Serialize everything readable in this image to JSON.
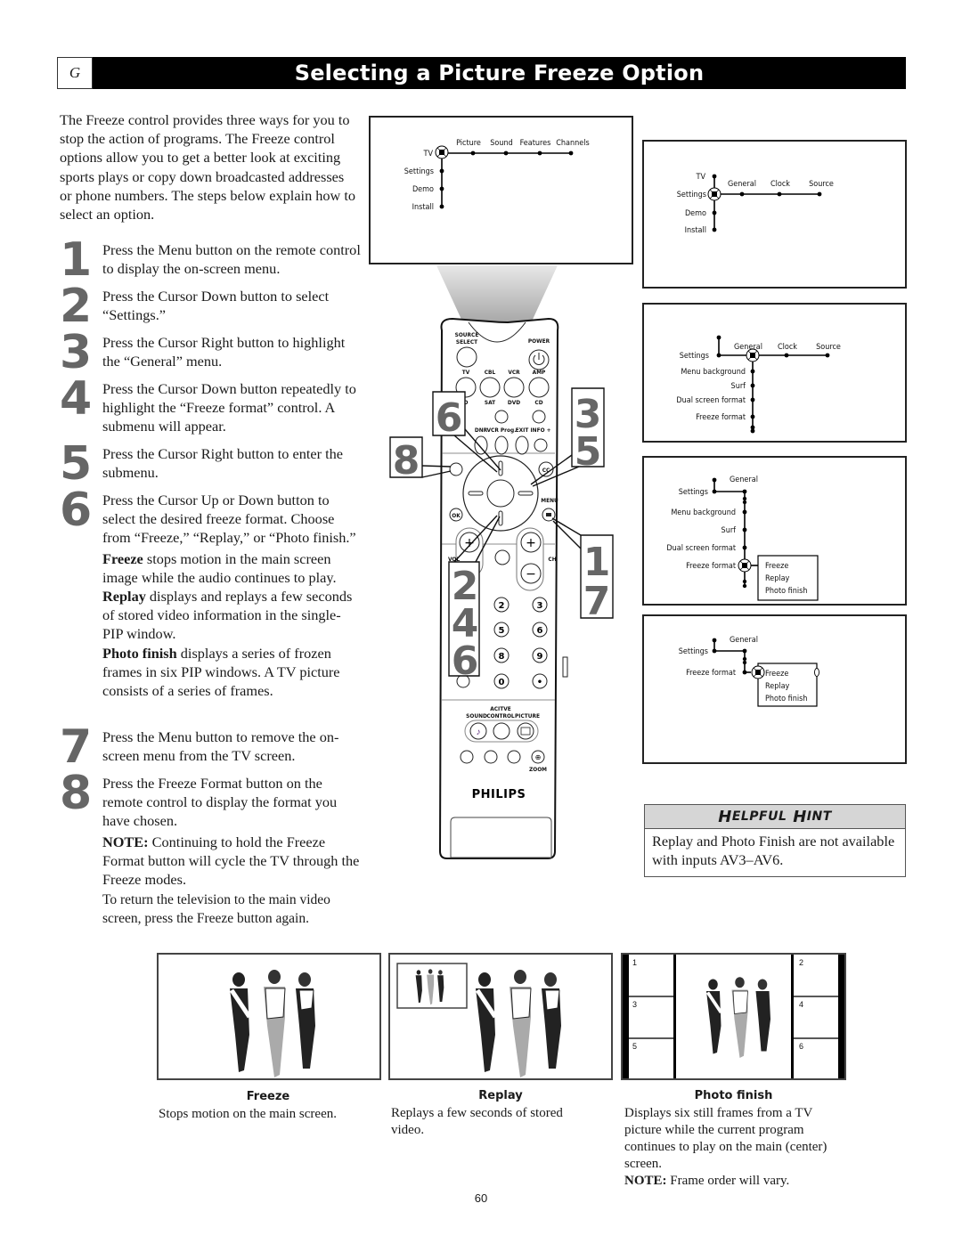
{
  "header": {
    "section_letter": "G",
    "title": "Selecting a Picture Freeze Option"
  },
  "intro": "The Freeze control provides three ways for you to stop the action of programs. The Freeze control options allow you to get a better look at exciting sports plays or copy down broadcasted addresses or phone numbers. The steps below explain how to select an option.",
  "steps": [
    {
      "number": "1",
      "text": "Press the Menu button on the remote control to display the on-screen menu."
    },
    {
      "number": "2",
      "text": "Press the Cursor Down button to select “Settings.”"
    },
    {
      "number": "3",
      "text": "Press the Cursor Right button to highlight the “General” menu."
    },
    {
      "number": "4",
      "text": "Press the Cursor Down button repeatedly to highlight the “Freeze format” control. A submenu will appear."
    },
    {
      "number": "5",
      "text": "Press the Cursor Right button to enter the submenu."
    },
    {
      "number": "6",
      "text": "Press the Cursor Up or Down button to select the desired freeze format. Choose from “Freeze,” “Replay,” or “Photo finish.”",
      "details": [
        {
          "term": "Freeze",
          "desc": " stops motion in the main screen image while the audio continues to play."
        },
        {
          "term": "Replay",
          "desc": " displays and replays a few seconds of stored video information in the single-PIP window."
        },
        {
          "term": "Photo finish",
          "desc": " displays a series of frozen frames in six PIP windows. A TV picture consists of a series of frames."
        }
      ]
    },
    {
      "number": "7",
      "text": "Press the Menu button to remove the on-screen menu from the TV screen."
    },
    {
      "number": "8",
      "text": "Press the Freeze Format button on the remote control to display the format you have chosen.",
      "note_label": "NOTE:",
      "note": " Continuing to hold the Freeze Format button will cycle the TV through the Freeze modes.",
      "extra": "To return the television to the main video screen, press the Freeze button again."
    }
  ],
  "menu_screens": {
    "screen1": {
      "root": "TV",
      "top_items": [
        "Picture",
        "Sound",
        "Features",
        "Channels"
      ],
      "side_items": [
        "Settings",
        "Demo",
        "Install"
      ]
    },
    "screen2": {
      "root": "TV",
      "selected": "Settings",
      "top_items": [
        "General",
        "Clock",
        "Source"
      ],
      "side_items": [
        "Demo",
        "Install"
      ]
    },
    "screen3": {
      "parent": "Settings",
      "selected": "General",
      "top_items": [
        "Clock",
        "Source"
      ],
      "side_items": [
        "Menu background",
        "Surf",
        "Dual screen format",
        "Freeze format"
      ]
    },
    "screen4": {
      "parent": "Settings",
      "top": "General",
      "side_items": [
        "Menu background",
        "Surf",
        "Dual screen format"
      ],
      "selected": "Freeze format",
      "submenu": [
        "Freeze",
        "Replay",
        "Photo finish"
      ]
    },
    "screen5": {
      "parent": "Settings",
      "top": "General",
      "item": "Freeze format",
      "submenu": [
        "Freeze",
        "Replay",
        "Photo finish"
      ]
    }
  },
  "remote": {
    "brand": "PHILIPS",
    "labels": {
      "source_select_1": "SOURCE",
      "source_select_2": "SELECT",
      "power": "POWER",
      "tv": "TV",
      "cbl": "CBL",
      "vcr": "VCR",
      "amp": "AMP",
      "d": "D",
      "sat": "SAT",
      "dvd": "DVD",
      "cd": "CD",
      "dnr": "DNR",
      "vcr_prog": "VCR Prog.",
      "exit": "EXIT",
      "info": "INFO +",
      "cc": "CC",
      "ok": "OK",
      "menu": "MENU",
      "vol": "VOL",
      "ch": "CH",
      "plus": "+",
      "minus": "−",
      "active_1": "ACITVE",
      "active_2": "CONTROL",
      "sound": "SOUND",
      "picture": "PICTURE",
      "zoom": "ZOOM",
      "digits": [
        "2",
        "3",
        "5",
        "6",
        "8",
        "9",
        "0",
        "•"
      ]
    },
    "callouts": {
      "left_top": "6",
      "left_mid": "8",
      "right_top": [
        "3",
        "5"
      ],
      "right_bottom": [
        "1",
        "7"
      ],
      "left_bottom": [
        "2",
        "4",
        "6"
      ]
    }
  },
  "hint": {
    "title_first": "H",
    "title_first_rest": "ELPFUL ",
    "title_second": "H",
    "title_second_rest": "INT",
    "text": "Replay and Photo Finish are not available with inputs AV3–AV6."
  },
  "examples": [
    {
      "title": "Freeze",
      "desc": "Stops motion on the main screen."
    },
    {
      "title": "Replay",
      "desc": "Replays a few seconds of stored video."
    },
    {
      "title": "Photo finish",
      "desc": "Displays six still frames from a TV picture while the current program continues to play on the main (center) screen.",
      "note_label": "NOTE:",
      "note": " Frame order will vary.",
      "frame_numbers": [
        "1",
        "2",
        "3",
        "4",
        "5",
        "6"
      ]
    }
  ],
  "page_number": "60"
}
